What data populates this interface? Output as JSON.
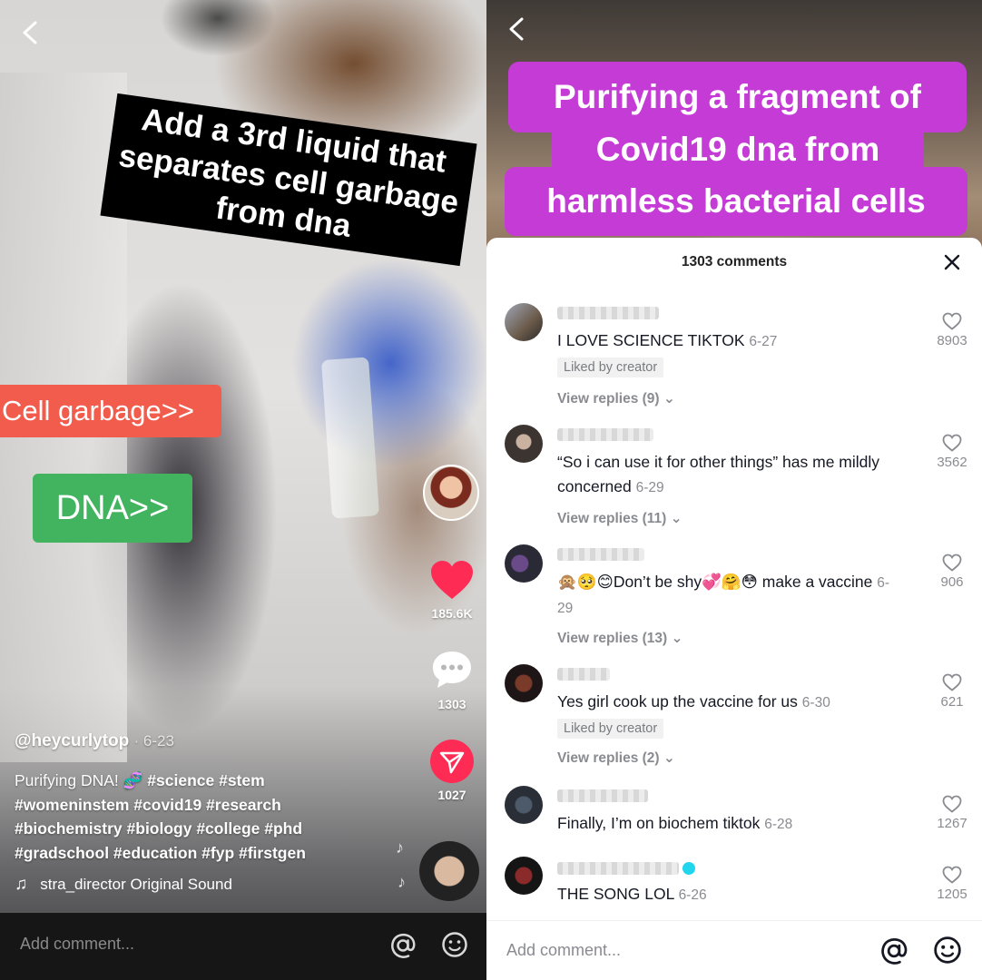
{
  "left": {
    "captions": {
      "black_lines": [
        "Add a 3rd liquid that",
        "separates cell garbage",
        "from dna"
      ],
      "orange": "Cell garbage>>",
      "green": "DNA>>"
    },
    "actions": {
      "likes": "185.6K",
      "comments": "1303",
      "shares": "1027"
    },
    "post": {
      "username": "@heycurlytop",
      "date": "· 6-23",
      "description": "Purifying DNA! 🧬",
      "hashtags_line1": " #science #stem",
      "hashtags_line2": "#womeninstem #covid19 #research",
      "hashtags_line3": "#biochemistry #biology #college #phd",
      "hashtags_line4": "#gradschool #education #fyp #firstgen",
      "sound": "stra_director Original Sound"
    },
    "comment_bar": {
      "placeholder": "Add comment..."
    }
  },
  "right": {
    "captions": {
      "line1": "Purifying a fragment of",
      "line2": "Covid19 dna from",
      "line3": "harmless bacterial cells"
    },
    "sheet": {
      "title": "1303 comments",
      "comments": [
        {
          "text": "I LOVE SCIENCE TIKTOK",
          "date": "6-27",
          "likes": "8903",
          "liked_by_creator": "Liked by creator",
          "replies": "View replies (9)"
        },
        {
          "text": "“So i can use it for other things” has me mildly concerned",
          "date": "6-29",
          "likes": "3562",
          "replies": "View replies (11)"
        },
        {
          "text": "🙊🥺😊Don’t be shy💞🤗😳 make a vaccine",
          "date": "6-29",
          "likes": "906",
          "replies": "View replies (13)"
        },
        {
          "text": "Yes girl cook up the vaccine for us",
          "date": "6-30",
          "likes": "621",
          "liked_by_creator": "Liked by creator",
          "replies": "View replies (2)"
        },
        {
          "text": "Finally, I’m on biochem tiktok",
          "date": "6-28",
          "likes": "1267"
        },
        {
          "text": "THE SONG LOL",
          "date": "6-26",
          "likes": "1205"
        }
      ]
    },
    "comment_bar": {
      "placeholder": "Add comment..."
    }
  },
  "colors": {
    "like_red": "#fe2c55",
    "caption_purple": "#c43bd6",
    "caption_orange": "#f25c4d",
    "caption_green": "#42b460"
  }
}
